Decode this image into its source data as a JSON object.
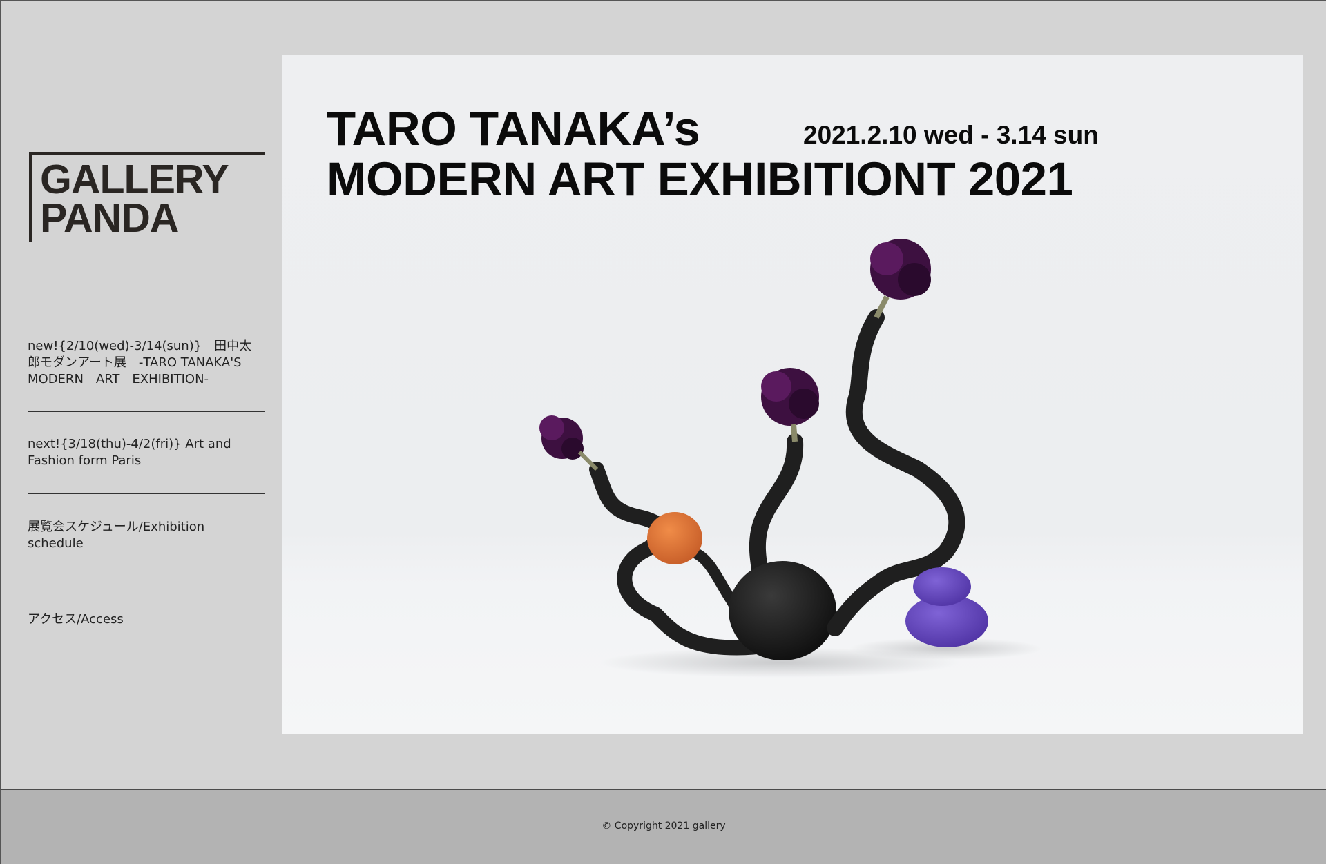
{
  "logo": {
    "text": "GALLERY\nPANDA"
  },
  "nav": {
    "items": [
      {
        "label": "new!{2/10(wed)-3/14(sun)}　田中太郎モダンアート展　-TARO TANAKA'S MODERN　ART　EXHIBITION-"
      },
      {
        "label": "next!{3/18(thu)-4/2(fri)} Art and Fashion form Paris"
      },
      {
        "label": "展覧会スケジュール/Exhibition schedule"
      },
      {
        "label": "アクセス/Access"
      }
    ]
  },
  "hero": {
    "title_line1": "TARO TANAKA’s",
    "title_line2": "MODERN ART EXHIBITIONT 2021",
    "date": "2021.2.10 wed - 3.14 sun"
  },
  "footer": {
    "copyright": "© Copyright 2021 gallery"
  },
  "colors": {
    "page_bg": "#d4d4d4",
    "footer_bg": "#b3b3b3",
    "logo": "#2a2623",
    "flower": "#3d1040",
    "orange_ball": "#e27a3a",
    "purple_ball": "#6b4bc4",
    "stem": "#1f1f1f"
  }
}
